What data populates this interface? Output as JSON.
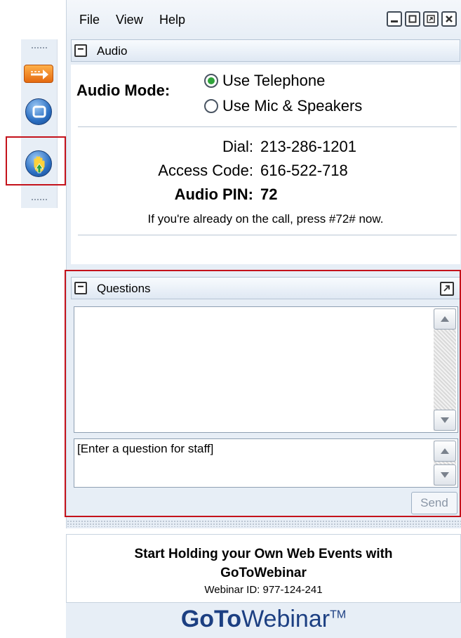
{
  "toolbar": {
    "icons": [
      "grip-icon",
      "arrow-right-icon",
      "stop-icon",
      "raise-hand-icon",
      "grip-icon"
    ]
  },
  "menu": {
    "items": [
      "File",
      "View",
      "Help"
    ],
    "window_buttons": [
      "minimize",
      "maximize",
      "restore",
      "close"
    ]
  },
  "audio": {
    "title": "Audio",
    "mode_label": "Audio Mode:",
    "options": [
      {
        "label": "Use Telephone",
        "checked": true
      },
      {
        "label": "Use Mic & Speakers",
        "checked": false
      }
    ],
    "dial_label": "Dial:",
    "dial_value": "213-286-1201",
    "access_label": "Access Code:",
    "access_value": "616-522-718",
    "pin_label": "Audio PIN:",
    "pin_value": "72",
    "note": "If you're already on the call, press #72# now."
  },
  "questions": {
    "title": "Questions",
    "placeholder": "[Enter a question for staff]",
    "send_label": "Send"
  },
  "promo": {
    "line1": "Start Holding your Own Web Events with",
    "line2": "GoToWebinar",
    "webinar_id": "Webinar ID: 977-124-241"
  },
  "brand": {
    "part1": "GoTo",
    "part2": "Webinar",
    "tm": "TM"
  },
  "colors": {
    "highlight": "#c4121b",
    "panel_bg": "#e7eef6",
    "brand": "#1c3f82",
    "radio_selected": "#2fa33a"
  }
}
